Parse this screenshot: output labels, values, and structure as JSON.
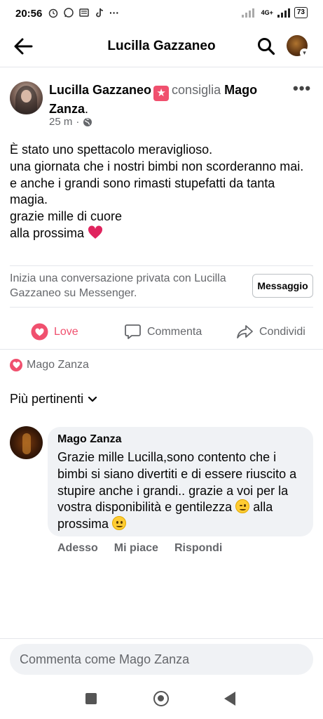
{
  "status_bar": {
    "time": "20:56",
    "more": "···",
    "network": "4G+",
    "battery": "73"
  },
  "header": {
    "title": "Lucilla Gazzaneo"
  },
  "post": {
    "author": "Lucilla Gazzaneo",
    "verb": "consiglia",
    "target": "Mago Zanza",
    "target_suffix": ".",
    "time": "25 m",
    "separator": "·",
    "more": "•••",
    "lines": [
      "È stato uno spettacolo meraviglioso.",
      "una giornata che i nostri bimbi non scorderanno mai.",
      "e anche i grandi sono rimasti stupefatti da tanta magia.",
      "grazie mille di cuore",
      "alla prossima"
    ]
  },
  "messenger": {
    "prompt": "Inizia una conversazione privata con Lucilla Gazzaneo su Messenger.",
    "button": "Messaggio"
  },
  "actions": {
    "love": "Love",
    "comment": "Commenta",
    "share": "Condividi"
  },
  "reaction": {
    "by": "Mago Zanza"
  },
  "sort": {
    "label": "Più pertinenti"
  },
  "comment": {
    "author": "Mago Zanza",
    "text_1": "Grazie mille Lucilla,sono contento che i bimbi si siano divertiti e di essere riuscito a stupire anche i grandi.. grazie a voi per la vostra disponibilità e gentilezza",
    "text_2": "alla prossima",
    "time": "Adesso",
    "like": "Mi piace",
    "reply": "Rispondi"
  },
  "composer": {
    "placeholder": "Commenta come Mago Zanza"
  },
  "colors": {
    "love": "#f0506e",
    "secondary_text": "#65676b",
    "bubble": "#f0f2f5"
  }
}
